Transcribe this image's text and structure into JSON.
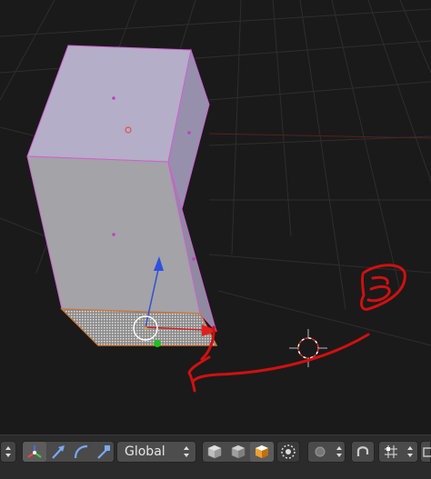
{
  "toolbar": {
    "orientation_value": "Global",
    "icons": [
      "scroll-arrows-icon",
      "manipulator-axes-icon",
      "translate-arrow-icon",
      "rotate-arc-icon",
      "scale-arrow-icon",
      "shade-solid-cube-icon",
      "shade-textured-cube-icon",
      "shade-material-cube-icon",
      "pivot-point-icon",
      "proportional-edit-icon",
      "snap-magnet-icon",
      "snap-element-icon",
      "render-camera-icon"
    ]
  },
  "viewport": {
    "object_colors": {
      "face_top": "#b5aec8",
      "face_front": "#a3a3a8",
      "face_side": "#9690ad",
      "selected_edge": "#d060d0",
      "selected_face": "#c87840",
      "annotation": "#d01010",
      "grid": "#2e2e2e"
    },
    "annotation_label": "3"
  }
}
